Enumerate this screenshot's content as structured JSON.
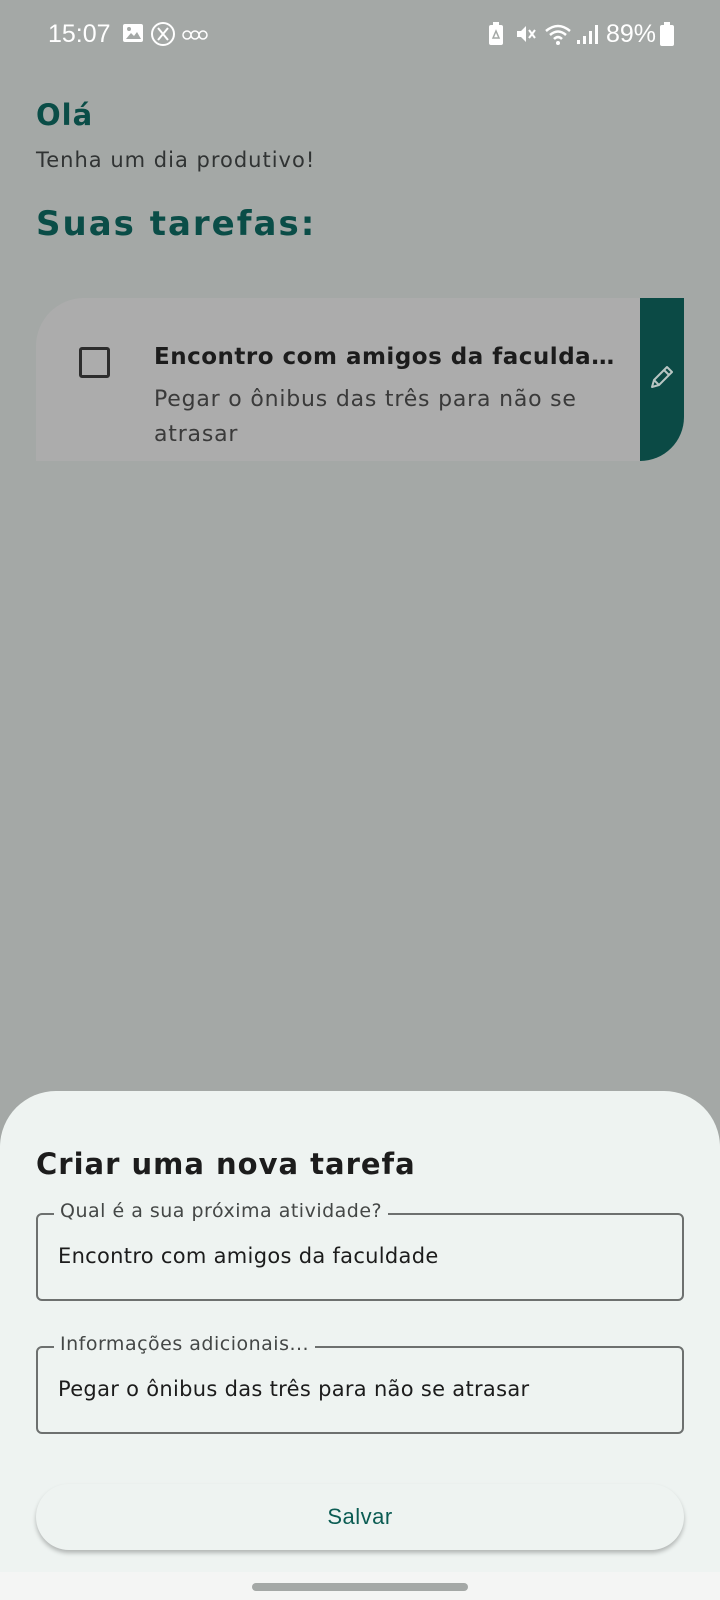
{
  "status_bar": {
    "time": "15:07",
    "battery_percent": "89%",
    "icons": [
      "gallery-icon",
      "x-app-icon",
      "notification-dots-icon",
      "battery-saver-icon",
      "mute-icon",
      "wifi-icon",
      "signal-icon",
      "battery-icon"
    ]
  },
  "greeting": {
    "title": "Olá",
    "subtitle": "Tenha um dia produtivo!"
  },
  "tasks_section": {
    "title": "Suas tarefas:",
    "tasks": [
      {
        "title": "Encontro com amigos da faculdade",
        "description": "Pegar o ônibus das três para não se atrasar",
        "checked": false,
        "edit_icon": "pencil-icon"
      }
    ]
  },
  "new_task_sheet": {
    "title": "Criar uma nova tarefa",
    "activity_field": {
      "label": "Qual é a sua próxima atividade?",
      "value": "Encontro com amigos da faculdade"
    },
    "info_field": {
      "label": "Informações adicionais...",
      "value": "Pegar o ônibus das três para não se atrasar"
    },
    "save_label": "Salvar"
  },
  "colors": {
    "accent": "#0b4a45",
    "heading": "#0a4d47",
    "scrim": "#a4a8a6",
    "sheet": "#eef3f1"
  }
}
